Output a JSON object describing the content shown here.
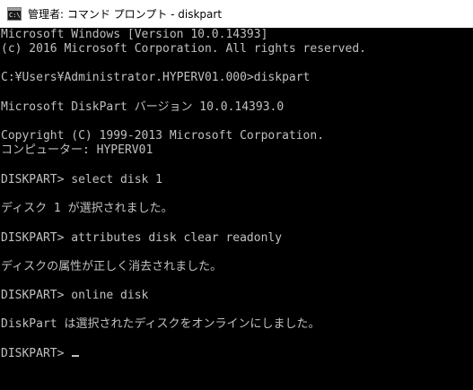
{
  "window": {
    "title": "管理者: コマンド プロンプト - diskpart",
    "icon": "cmd-console-icon",
    "icon_glyph": "C:\\>"
  },
  "console": {
    "lines": [
      "Microsoft Windows [Version 10.0.14393]",
      "(c) 2016 Microsoft Corporation. All rights reserved.",
      "C:¥Users¥Administrator.HYPERV01.000>diskpart",
      "Microsoft DiskPart バージョン 10.0.14393.0",
      "Copyright (C) 1999-2013 Microsoft Corporation.",
      "コンピューター: HYPERV01",
      "DISKPART> select disk 1",
      "ディスク 1 が選択されました。",
      "DISKPART> attributes disk clear readonly",
      "ディスクの属性が正しく消去されました。",
      "DISKPART> online disk",
      "DiskPart は選択されたディスクをオンラインにしました。",
      "DISKPART> "
    ]
  },
  "colors": {
    "console_bg": "#000000",
    "console_text": "#c0c0c0",
    "titlebar_bg": "#ffffff"
  }
}
